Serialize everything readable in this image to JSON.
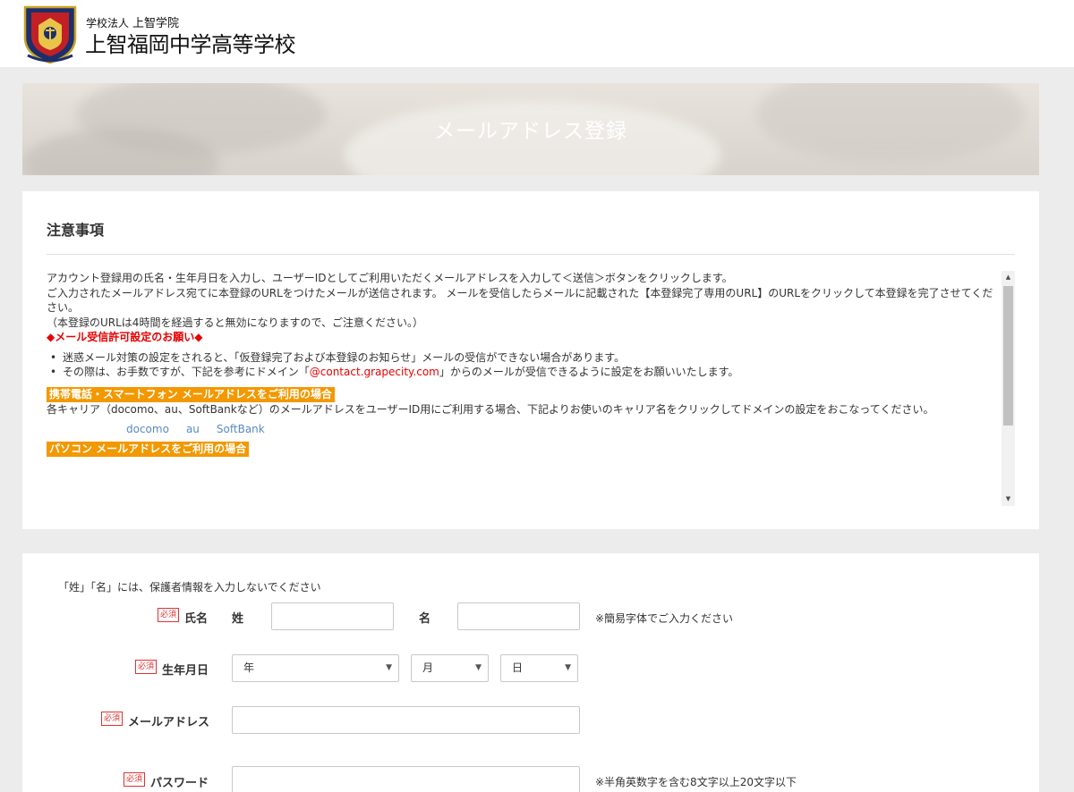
{
  "header": {
    "corp_prefix": "学校法人",
    "corp_name": "上智学院",
    "school_name": "上智福岡中学高等学校"
  },
  "hero": {
    "title": "メールアドレス登録"
  },
  "notice": {
    "title": "注意事項",
    "para1": "アカウント登録用の氏名・生年月日を入力し、ユーザーIDとしてご利用いただくメールアドレスを入力して＜送信＞ボタンをクリックします。",
    "para2": "ご入力されたメールアドレス宛てに本登録のURLをつけたメールが送信されます。 メールを受信したらメールに記載された【本登録完了専用のURL】のURLをクリックして本登録を完了させてください。",
    "para3": "（本登録のURLは4時間を経過すると無効になりますので、ご注意ください。）",
    "red_heading": "◆メール受信許可設定のお願い◆",
    "bullet1": "迷惑メール対策の設定をされると、「仮登録完了および本登録のお知らせ」メールの受信ができない場合があります。",
    "bullet2_pre": "その際は、お手数ですが、下記を参考にドメイン「",
    "bullet2_domain": "@contact.grapecity.com",
    "bullet2_post": "」からのメールが受信できるように設定をお願いいたします。",
    "mobile_label": "携帯電話・スマートフォン メールアドレスをご利用の場合",
    "carrier_text": "各キャリア（docomo、au、SoftBankなど）のメールアドレスをユーザーID用にご利用する場合、下記よりお使いのキャリア名をクリックしてドメインの設定をおこなってください。",
    "carriers": [
      "docomo",
      "au",
      "SoftBank"
    ],
    "pc_label": "パソコン メールアドレスをご利用の場合",
    "scroll_up": "▲",
    "scroll_down": "▼"
  },
  "form": {
    "note": "「姓」「名」には、保護者情報を入力しないでください",
    "required_badge": "必須",
    "name": {
      "label": "氏名",
      "last_label": "姓",
      "first_label": "名",
      "last_value": "",
      "first_value": "",
      "hint": "※簡易字体でご入力ください"
    },
    "birthdate": {
      "label": "生年月日",
      "year": "年",
      "month": "月",
      "day": "日",
      "caret": "▼"
    },
    "email": {
      "label": "メールアドレス",
      "value": ""
    },
    "password": {
      "label": "パスワード",
      "value": "",
      "hint": "※半角英数字を含む8文字以上20文字以下"
    }
  },
  "colors": {
    "required_red": "#dd3333",
    "notice_red": "#e60000",
    "label_orange": "#f39800",
    "link_blue": "#5a8ac4"
  }
}
